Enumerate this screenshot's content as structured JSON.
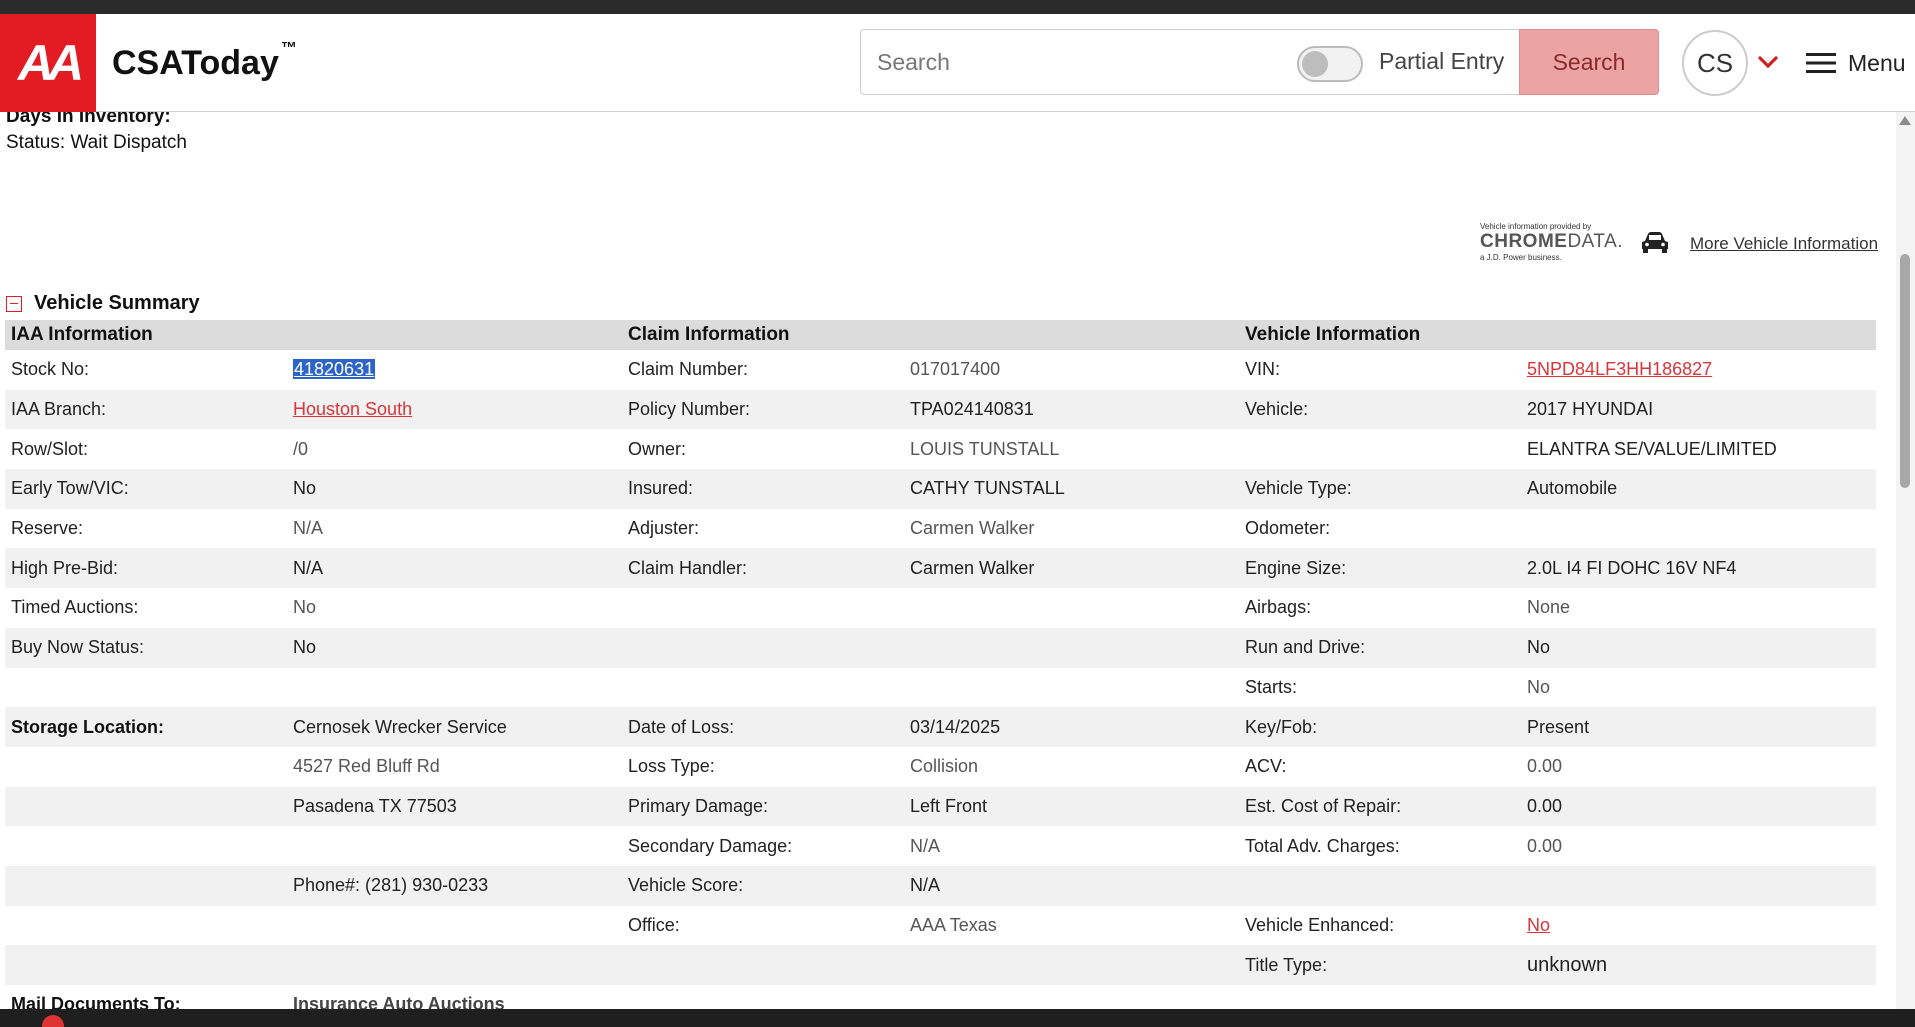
{
  "header": {
    "app_name": "CSAToday",
    "trademark": "™",
    "logo_text": "AA",
    "search_placeholder": "Search",
    "partial_entry_label": "Partial Entry",
    "search_button_label": "Search",
    "avatar_initials": "CS",
    "menu_label": "Menu"
  },
  "inventory": {
    "days_label": "Days In Inventory:",
    "status_label": "Status:",
    "status_value": "Wait Dispatch"
  },
  "chrome": {
    "provided_by": "Vehicle information provided by",
    "brand_bold": "CHROME",
    "brand_light": "DATA.",
    "tagline": "a J.D. Power business.",
    "more_link": "More Vehicle Information"
  },
  "summary": {
    "title": "Vehicle Summary",
    "headers": {
      "iaa": "IAA Information",
      "claim": "Claim Information",
      "vehicle": "Vehicle Information"
    },
    "rows": [
      {
        "l1": "Stock No:",
        "v1": "41820631",
        "l2": "Claim Number:",
        "v2": "017017400",
        "l3": "VIN:",
        "v3": "5NPD84LF3HH186827"
      },
      {
        "l1": "IAA Branch:",
        "v1": "Houston South",
        "l2": "Policy Number:",
        "v2": "TPA024140831",
        "l3": "Vehicle:",
        "v3": "2017 HYUNDAI"
      },
      {
        "l1": "Row/Slot:",
        "v1": "/0",
        "l2": "Owner:",
        "v2": "LOUIS TUNSTALL",
        "l3": "",
        "v3": "ELANTRA SE/VALUE/LIMITED"
      },
      {
        "l1": "Early Tow/VIC:",
        "v1": "No",
        "l2": "Insured:",
        "v2": "CATHY TUNSTALL",
        "l3": "Vehicle Type:",
        "v3": "Automobile"
      },
      {
        "l1": "Reserve:",
        "v1": "N/A",
        "l2": "Adjuster:",
        "v2": "Carmen Walker",
        "l3": "Odometer:",
        "v3": ""
      },
      {
        "l1": "High Pre-Bid:",
        "v1": "N/A",
        "l2": "Claim Handler:",
        "v2": "Carmen Walker",
        "l3": "Engine Size:",
        "v3": "2.0L I4 FI DOHC 16V NF4"
      },
      {
        "l1": "Timed Auctions:",
        "v1": "No",
        "l2": "",
        "v2": "",
        "l3": "Airbags:",
        "v3": "None"
      },
      {
        "l1": "Buy Now Status:",
        "v1": "No",
        "l2": "",
        "v2": "",
        "l3": "Run and Drive:",
        "v3": "No"
      },
      {
        "l1": "",
        "v1": "",
        "l2": "",
        "v2": "",
        "l3": "Starts:",
        "v3": "No"
      },
      {
        "l1": "Storage Location:",
        "v1": "Cernosek Wrecker Service",
        "l2": "Date of Loss:",
        "v2": "03/14/2025",
        "l3": "Key/Fob:",
        "v3": "Present"
      },
      {
        "l1": "",
        "v1": "4527 Red Bluff Rd",
        "l2": "Loss Type:",
        "v2": "Collision",
        "l3": "ACV:",
        "v3": "0.00"
      },
      {
        "l1": "",
        "v1": "Pasadena TX 77503",
        "l2": "Primary Damage:",
        "v2": "Left Front",
        "l3": "Est. Cost of Repair:",
        "v3": "0.00"
      },
      {
        "l1": "",
        "v1": "",
        "l2": "Secondary Damage:",
        "v2": "N/A",
        "l3": "Total Adv. Charges:",
        "v3": "0.00"
      },
      {
        "l1": "",
        "v1": "Phone#: (281) 930-0233",
        "l2": "Vehicle Score:",
        "v2": "N/A",
        "l3": "",
        "v3": ""
      },
      {
        "l1": "",
        "v1": "",
        "l2": "Office:",
        "v2": "AAA Texas",
        "l3": "Vehicle Enhanced:",
        "v3": "No"
      },
      {
        "l1": "",
        "v1": "",
        "l2": "",
        "v2": "",
        "l3": "Title Type:",
        "v3": "unknown"
      },
      {
        "l1": "Mail Documents To:",
        "v1": "Insurance Auto Auctions",
        "l2": "",
        "v2": "",
        "l3": "",
        "v3": ""
      }
    ]
  },
  "colors": {
    "brand_red": "#e31b23",
    "search_button": "#eba3a3",
    "link_red": "#d9343a",
    "selection_blue": "#2d64c9"
  }
}
